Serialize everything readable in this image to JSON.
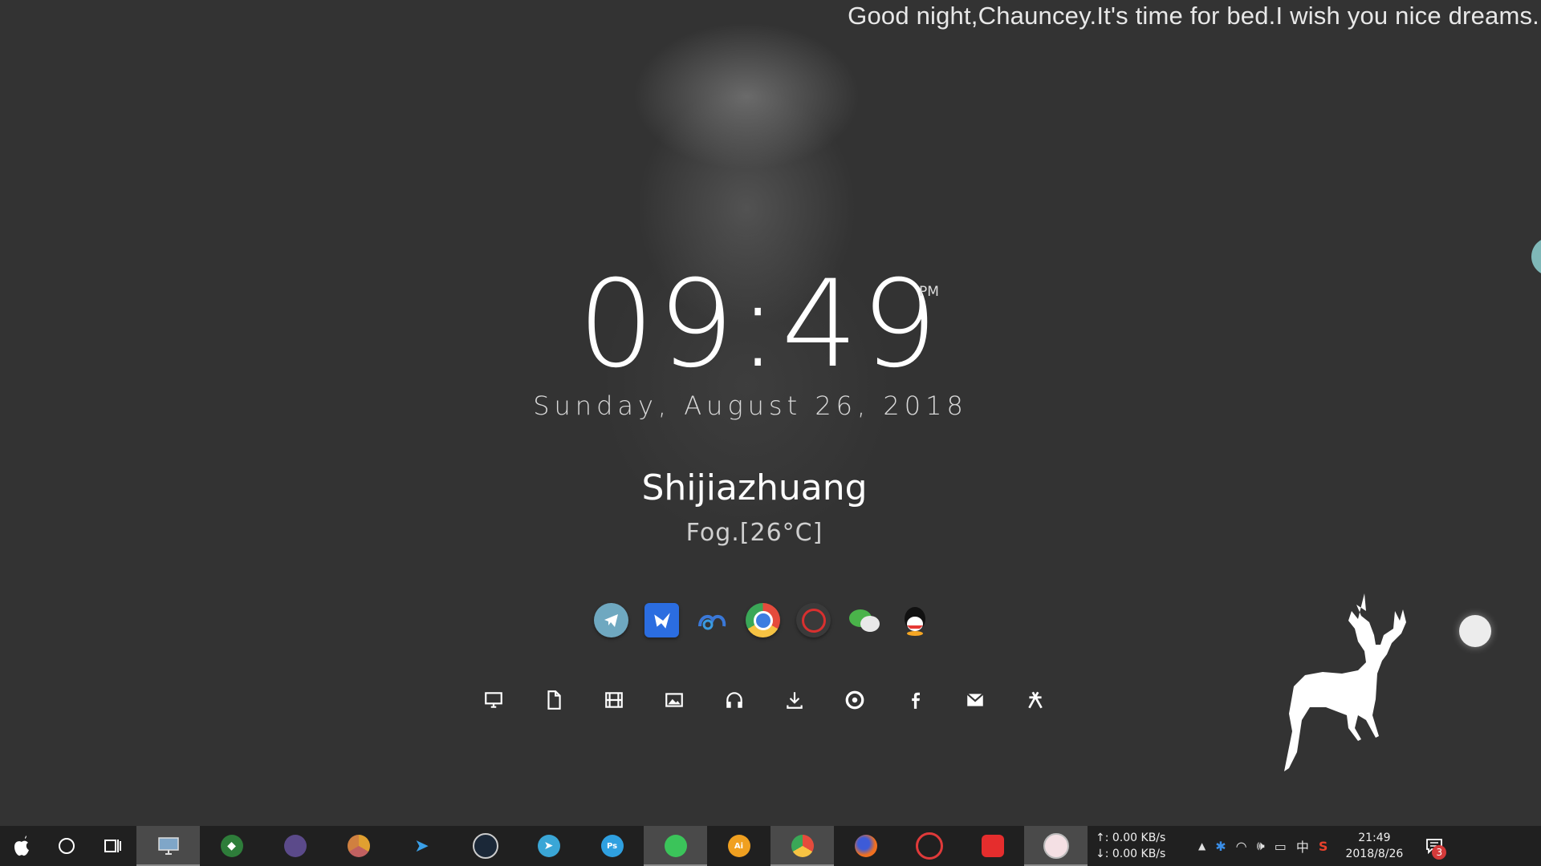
{
  "greeting": "Good night,Chauncey.It's time for bed.I wish you nice dreams.",
  "clock": {
    "time": "09:49",
    "ampm": "PM",
    "date": "Sunday, August 26, 2018"
  },
  "weather": {
    "city": "Shijiazhuang",
    "condition": "Fog.[26°C]"
  },
  "launcher_apps": [
    {
      "icon": "telegram-icon",
      "color": "#6fa8c0"
    },
    {
      "icon": "feishu-icon",
      "color": "#2b6de0"
    },
    {
      "icon": "baidu-netdisk-icon",
      "color": "#3a78d8"
    },
    {
      "icon": "chrome-icon",
      "color": "#e54b3c"
    },
    {
      "icon": "netease-music-icon",
      "color": "#d8302f"
    },
    {
      "icon": "wechat-icon",
      "color": "#4ab34a"
    },
    {
      "icon": "qq-icon",
      "color": "#222222"
    }
  ],
  "toolbar_icons": [
    "computer-icon",
    "document-icon",
    "film-icon",
    "image-icon",
    "headphones-icon",
    "download-icon",
    "chrome-icon",
    "facebook-icon",
    "mail-icon",
    "zhihu-icon"
  ],
  "taskbar": {
    "apps": [
      {
        "icon": "desktop-icon",
        "active": true
      },
      {
        "icon": "green-shield-icon",
        "active": false
      },
      {
        "icon": "eclipse-icon",
        "active": false
      },
      {
        "icon": "chrome-canary-icon",
        "active": false
      },
      {
        "icon": "feishu-icon",
        "active": false
      },
      {
        "icon": "steam-icon",
        "active": false
      },
      {
        "icon": "telegram-icon",
        "active": false
      },
      {
        "icon": "photoshop-icon",
        "active": false
      },
      {
        "icon": "wechat-icon",
        "active": true
      },
      {
        "icon": "illustrator-icon",
        "active": false
      },
      {
        "icon": "chrome-icon",
        "active": true
      },
      {
        "icon": "firefox-icon",
        "active": false
      },
      {
        "icon": "netease-music-icon",
        "active": false
      },
      {
        "icon": "media-player-icon",
        "active": false
      },
      {
        "icon": "user-avatar-icon",
        "active": true
      }
    ],
    "net_up": "↑: 0.00 KB/s",
    "net_down": "↓: 0.00 KB/s",
    "ime": "中",
    "time": "21:49",
    "date": "2018/8/26",
    "notification_count": "3"
  }
}
